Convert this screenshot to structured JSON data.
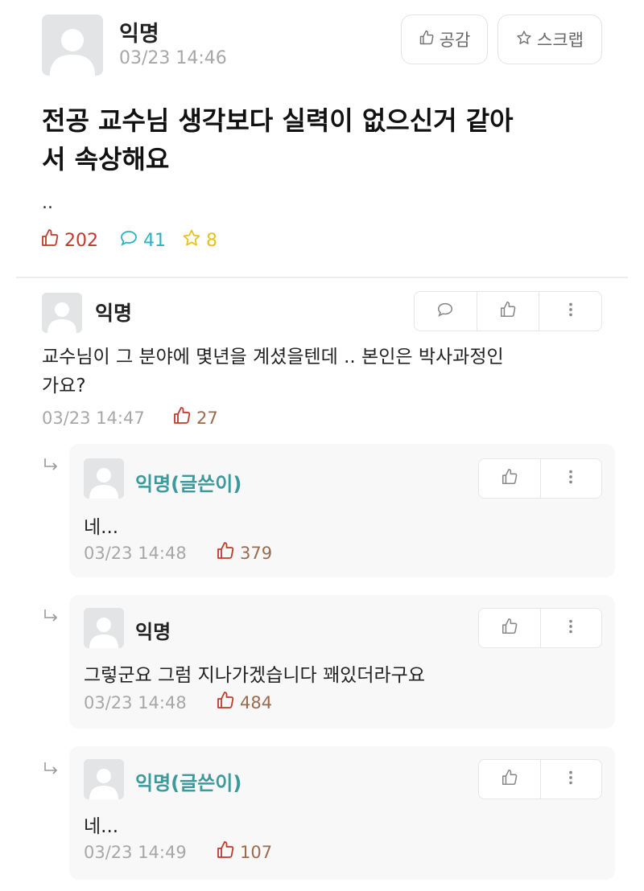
{
  "post": {
    "author": "익명",
    "date": "03/23 14:46",
    "like_button": "공감",
    "scrap_button": "스크랩",
    "title_line1": "전공 교수님 생각보다 실력이 없으신거 같아",
    "title_line2": "서 속상해요",
    "body": "..",
    "likes": "202",
    "comments": "41",
    "scraps": "8"
  },
  "comment": {
    "author": "익명",
    "text_line1": "교수님이 그 분야에 몇년을 계셨을텐데 .. 본인은 박사과정인",
    "text_line2": "가요?",
    "date": "03/23 14:47",
    "likes": "27"
  },
  "replies": [
    {
      "author": "익명(글쓴이)",
      "text": "네...",
      "date": "03/23 14:48",
      "likes": "379"
    },
    {
      "author": "익명",
      "text": "그렇군요 그럼 지나가겠습니다 꽤있더라구요",
      "date": "03/23 14:48",
      "likes": "484"
    },
    {
      "author": "익명(글쓴이)",
      "text": "네...",
      "date": "03/23 14:49",
      "likes": "107"
    }
  ],
  "colors": {
    "like": "#c0392b",
    "comment": "#2bb2c4",
    "scrap": "#e8c21a",
    "op_nick": "#3d9a9c"
  }
}
